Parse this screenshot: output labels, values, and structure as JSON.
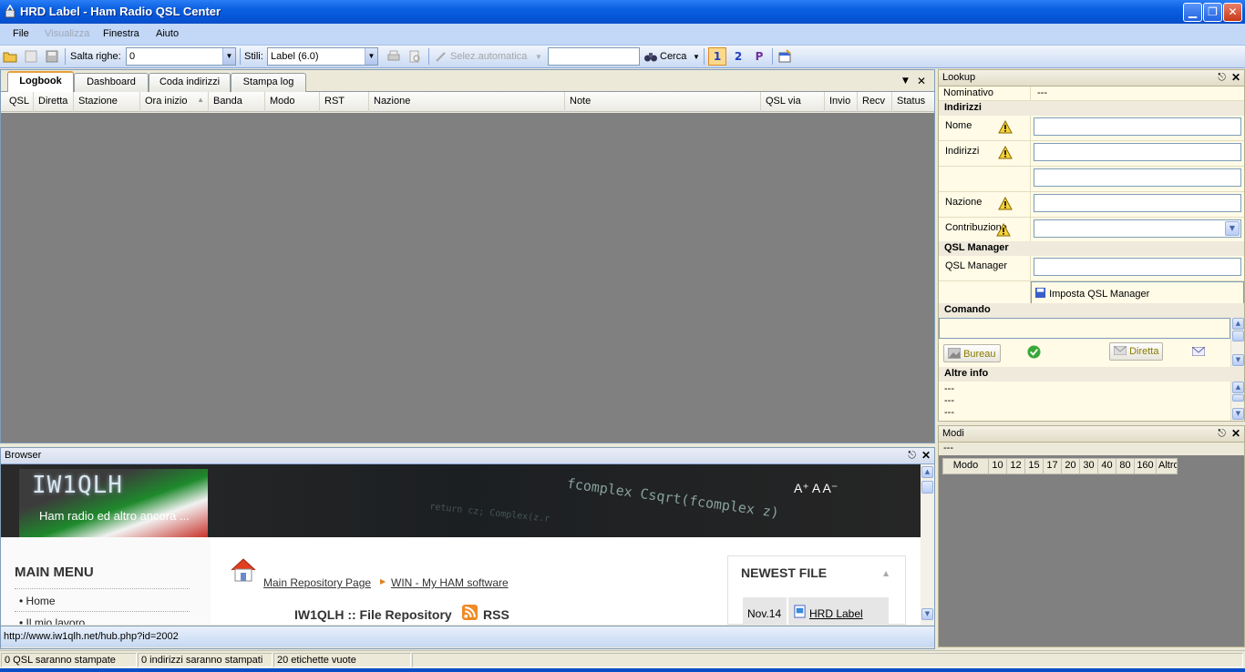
{
  "window": {
    "title": "HRD Label - Ham Radio QSL Center"
  },
  "menu": {
    "items": [
      "File",
      "Visualizza",
      "Finestra",
      "Aiuto"
    ]
  },
  "toolbar": {
    "salta_label": "Salta righe:",
    "salta_value": "0",
    "stili_label": "Stili:",
    "stili_value": "Label (6.0)",
    "selez_label": "Selez.automatica",
    "search_value": "",
    "cerca_label": "Cerca",
    "page_buttons": [
      "1",
      "2",
      "P"
    ]
  },
  "logbook": {
    "tabs": [
      "Logbook",
      "Dashboard",
      "Coda indirizzi",
      "Stampa log"
    ],
    "columns": [
      "QSL",
      "Diretta",
      "Stazione",
      "Ora inizio",
      "Banda",
      "Modo",
      "RST",
      "Nazione",
      "Note",
      "QSL via",
      "Invio",
      "Recv",
      "Status"
    ]
  },
  "lookup": {
    "title": "Lookup",
    "nominativo_label": "Nominativo",
    "nominativo_value": "---",
    "indirizzi_section": "Indirizzi",
    "nome_label": "Nome",
    "indirizzi_label": "Indirizzi",
    "nazione_label": "Nazione",
    "contribuzione_label": "Contribuzione",
    "qsl_manager_section": "QSL Manager",
    "qsl_manager_label": "QSL Manager",
    "imposta_button": "Imposta QSL Manager",
    "comando_section": "Comando",
    "bureau_button": "Bureau",
    "diretta_button": "Diretta",
    "altre_info_section": "Altre info",
    "altre_info_lines": [
      "---",
      "---",
      "---"
    ]
  },
  "modi": {
    "title": "Modi",
    "dash": "---",
    "columns": [
      "Modo",
      "10",
      "12",
      "15",
      "17",
      "20",
      "30",
      "40",
      "80",
      "160",
      "Altro"
    ]
  },
  "browser": {
    "title": "Browser",
    "site_brand": "IW1QLH",
    "site_tagline": "Ham radio ed altro ancora ...",
    "font_controls": "A⁺ A A⁻",
    "banner_code": "fcomplex Csqrt(fcomplex z)",
    "main_menu_title": "MAIN MENU",
    "main_menu_items": [
      "Home",
      "Il mio lavoro"
    ],
    "breadcrumb": [
      "Main Repository Page",
      "WIN - My HAM software"
    ],
    "repo_title": "IW1QLH :: File Repository",
    "rss_label": "RSS",
    "newest_title": "NEWEST FILE",
    "newest_date": "Nov.14",
    "newest_file": "HRD Label",
    "status_url": "http://www.iw1qlh.net/hub.php?id=2002"
  },
  "statusbar": {
    "cells": [
      "0 QSL saranno stampate",
      "0 indirizzi saranno stampati",
      "20 etichette vuote"
    ]
  }
}
